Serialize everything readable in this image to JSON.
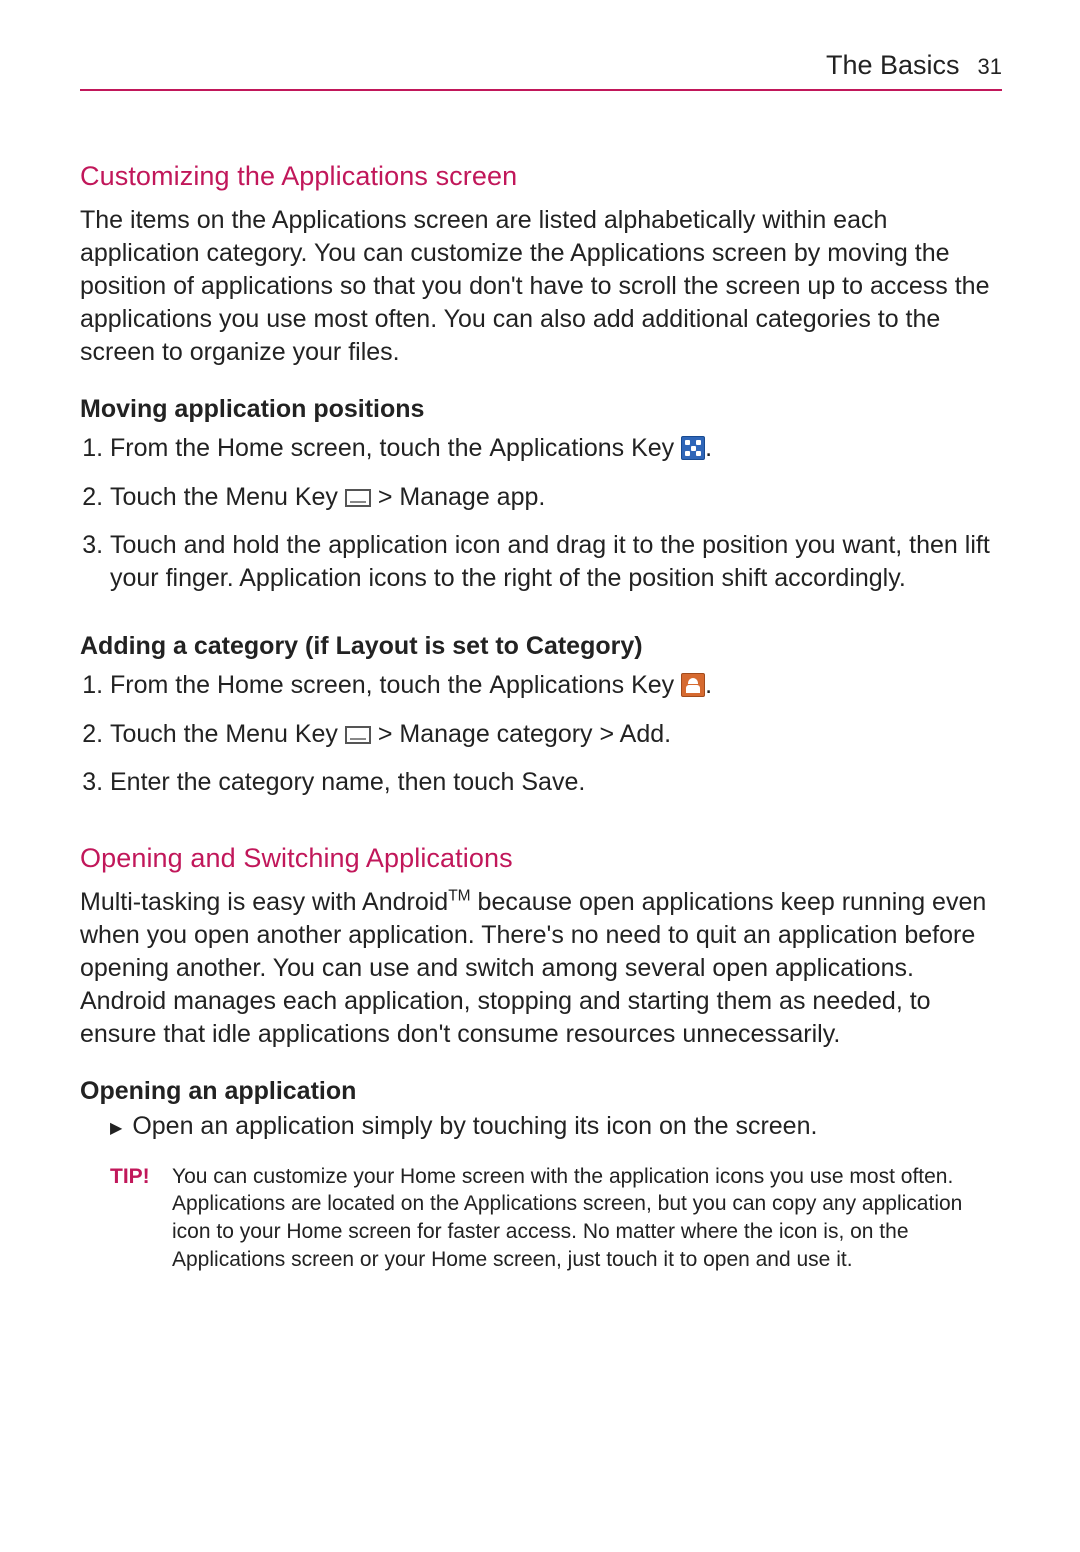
{
  "header": {
    "title": "The Basics",
    "page_num": "31"
  },
  "sections": {
    "customizing": {
      "heading": "Customizing the Applications screen",
      "body": "The items on the Applications screen are listed alphabetically within each application category. You can customize the Applications screen by moving the position of applications so that you don't have to scroll the screen up to access the applications you use most often. You can also add additional categories to the screen to organize your files."
    },
    "moving": {
      "heading": "Moving application positions",
      "step1_a": "From the Home screen, touch the ",
      "step1_b": "Applications Key ",
      "step2_a": "Touch the ",
      "step2_b": "Menu Key ",
      "step2_c": " > ",
      "step2_d": "Manage app",
      "step3": "Touch and hold the application icon and drag it to the position you want, then lift your finger. Application icons to the right of the position shift accordingly."
    },
    "adding": {
      "heading": "Adding a category (if Layout is set to Category)",
      "step1_a": "From the Home screen, touch the ",
      "step1_b": "Applications Key ",
      "step2_a": "Touch the ",
      "step2_b": "Menu Key ",
      "step2_c": " > ",
      "step2_d": "Manage category > Add.",
      "step3_a": "Enter the category name, then touch ",
      "step3_b": "Save"
    },
    "opening_switching": {
      "heading": "Opening and Switching Applications",
      "body_a": "Multi-tasking is easy with Android",
      "body_b": " because open applications keep running even when you open another application. There's no need to quit an application before opening another. You can use and switch among several open applications. Android manages each application, stopping and starting them as needed, to ensure that idle applications don't consume resources unnecessarily."
    },
    "opening_app": {
      "heading": "Opening an application",
      "bullet": "Open an application simply by touching its icon on the screen.",
      "tip_label": "TIP!",
      "tip_text": "You can customize your Home screen with the application icons you use most often. Applications are located on the Applications screen, but you can copy any application icon to your Home screen for faster access. No matter where the icon is, on the Applications screen or your Home screen, just touch it to open and use it."
    }
  },
  "tm": "TM",
  "period": "."
}
